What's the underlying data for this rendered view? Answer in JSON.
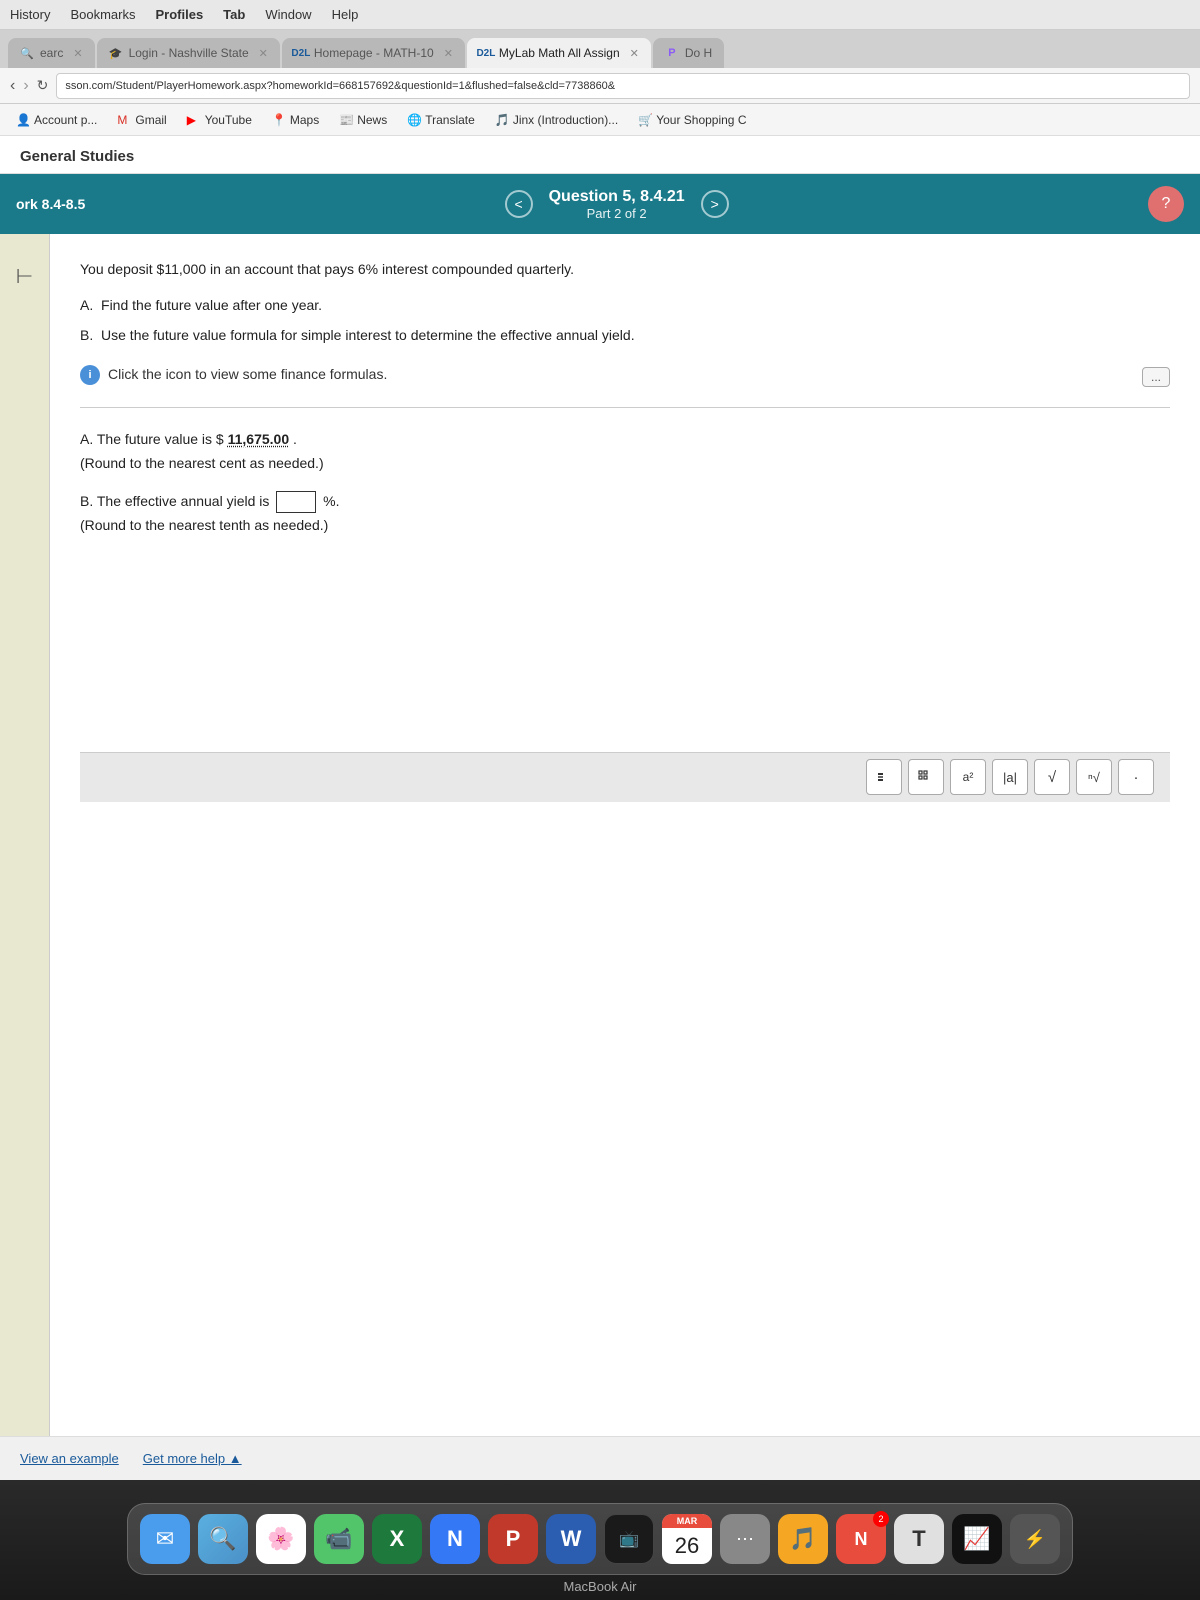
{
  "menu": {
    "items": [
      "History",
      "Bookmarks",
      "Profiles",
      "Tab",
      "Window",
      "Help"
    ]
  },
  "tabs": [
    {
      "id": "search",
      "label": "Search",
      "active": false,
      "favicon": "🔍"
    },
    {
      "id": "login",
      "label": "Login - Nashville State",
      "active": false,
      "favicon": "🎓"
    },
    {
      "id": "homepage",
      "label": "D2L Homepage - MATH-10",
      "active": false,
      "favicon": "📚"
    },
    {
      "id": "mylab",
      "label": "D2L MyLab Math All Assign",
      "active": true,
      "favicon": "📐"
    },
    {
      "id": "doh",
      "label": "Do H",
      "active": false,
      "favicon": "P"
    }
  ],
  "address_bar": {
    "url": "sson.com/Student/PlayerHomework.aspx?homeworkId=668157692&questionId=1&flushed=false&cld=7738860&"
  },
  "bookmarks": [
    {
      "id": "account",
      "label": "Account p...",
      "icon": "👤"
    },
    {
      "id": "gmail",
      "label": "Gmail",
      "icon": "✉️"
    },
    {
      "id": "youtube",
      "label": "YouTube",
      "icon": "▶️"
    },
    {
      "id": "maps",
      "label": "Maps",
      "icon": "📍"
    },
    {
      "id": "news",
      "label": "News",
      "icon": "📰"
    },
    {
      "id": "translate",
      "label": "Translate",
      "icon": "🌐"
    },
    {
      "id": "jinx",
      "label": "Jinx (Introduction)...",
      "icon": "🎵"
    },
    {
      "id": "shopping",
      "label": "Your Shopping C",
      "icon": "🛒"
    }
  ],
  "page": {
    "section_title": "General Studies",
    "question_nav": {
      "left_label": "ork 8.4-8.5",
      "question_title": "Question 5, 8.4.21",
      "question_subtitle": "Part 2 of 2",
      "prev_label": "<",
      "next_label": ">"
    },
    "question_text": "You deposit $11,000 in an account that pays 6% interest compounded quarterly.",
    "parts": {
      "a_label": "A.",
      "a_text": "Find the future value after one year.",
      "b_label": "B.",
      "b_text": "Use the future value formula for simple interest to determine the effective annual yield."
    },
    "info_text": "Click the icon to view some finance formulas.",
    "expand_btn_label": "...",
    "answer_a_prefix": "A.  The future value is $",
    "answer_a_value": "11,675.00",
    "answer_a_suffix": ".",
    "answer_a_note": "(Round to the nearest cent as needed.)",
    "answer_b_prefix": "B.  The effective annual yield is",
    "answer_b_suffix": "%.",
    "answer_b_note": "(Round to the nearest tenth as needed.)",
    "math_buttons": [
      "⊞",
      "⊟",
      "▪",
      "│▪│",
      "√",
      "√·",
      "·"
    ],
    "bottom_links": {
      "example": "View an example",
      "help": "Get more help ▲"
    }
  },
  "dock": {
    "items": [
      {
        "id": "mail",
        "label": "Mail",
        "icon": "✉",
        "color": "#4a9ced",
        "bg": "#4a9ced"
      },
      {
        "id": "finder",
        "label": "Finder",
        "icon": "🔍",
        "bg": "#5ab0e0"
      },
      {
        "id": "photos",
        "label": "Photos",
        "icon": "🌸",
        "bg": "#fff"
      },
      {
        "id": "facetime",
        "label": "FaceTime",
        "icon": "📹",
        "bg": "#52c46a"
      },
      {
        "id": "excel",
        "label": "Excel",
        "icon": "X",
        "bg": "#1e7a3c"
      },
      {
        "id": "notes",
        "label": "Notes",
        "icon": "N",
        "bg": "#3478f6"
      },
      {
        "id": "powerpoint",
        "label": "PowerPoint",
        "icon": "P",
        "bg": "#c0392b"
      },
      {
        "id": "word",
        "label": "Word",
        "icon": "W",
        "bg": "#2b5db0"
      },
      {
        "id": "appletv",
        "label": "Apple TV",
        "icon": "📺",
        "bg": "#222"
      },
      {
        "id": "calendar",
        "label": "Calendar",
        "month": "MAR",
        "date": "26",
        "badge": null
      },
      {
        "id": "launchpad",
        "label": "Launchpad",
        "icon": "⋯",
        "bg": "#888"
      },
      {
        "id": "music",
        "label": "Music",
        "icon": "🎵",
        "bg": "#f5a623"
      },
      {
        "id": "news",
        "label": "News",
        "icon": "N",
        "bg": "#e74c3c",
        "badge": null
      },
      {
        "id": "texteditor",
        "label": "Text Editor",
        "icon": "T",
        "bg": "#aaa"
      },
      {
        "id": "stocks",
        "label": "Stocks",
        "icon": "📈",
        "bg": "#2ecc71"
      },
      {
        "id": "other",
        "label": "Other",
        "icon": "⚡",
        "bg": "#888"
      }
    ],
    "macbook_label": "MacBook Air"
  }
}
